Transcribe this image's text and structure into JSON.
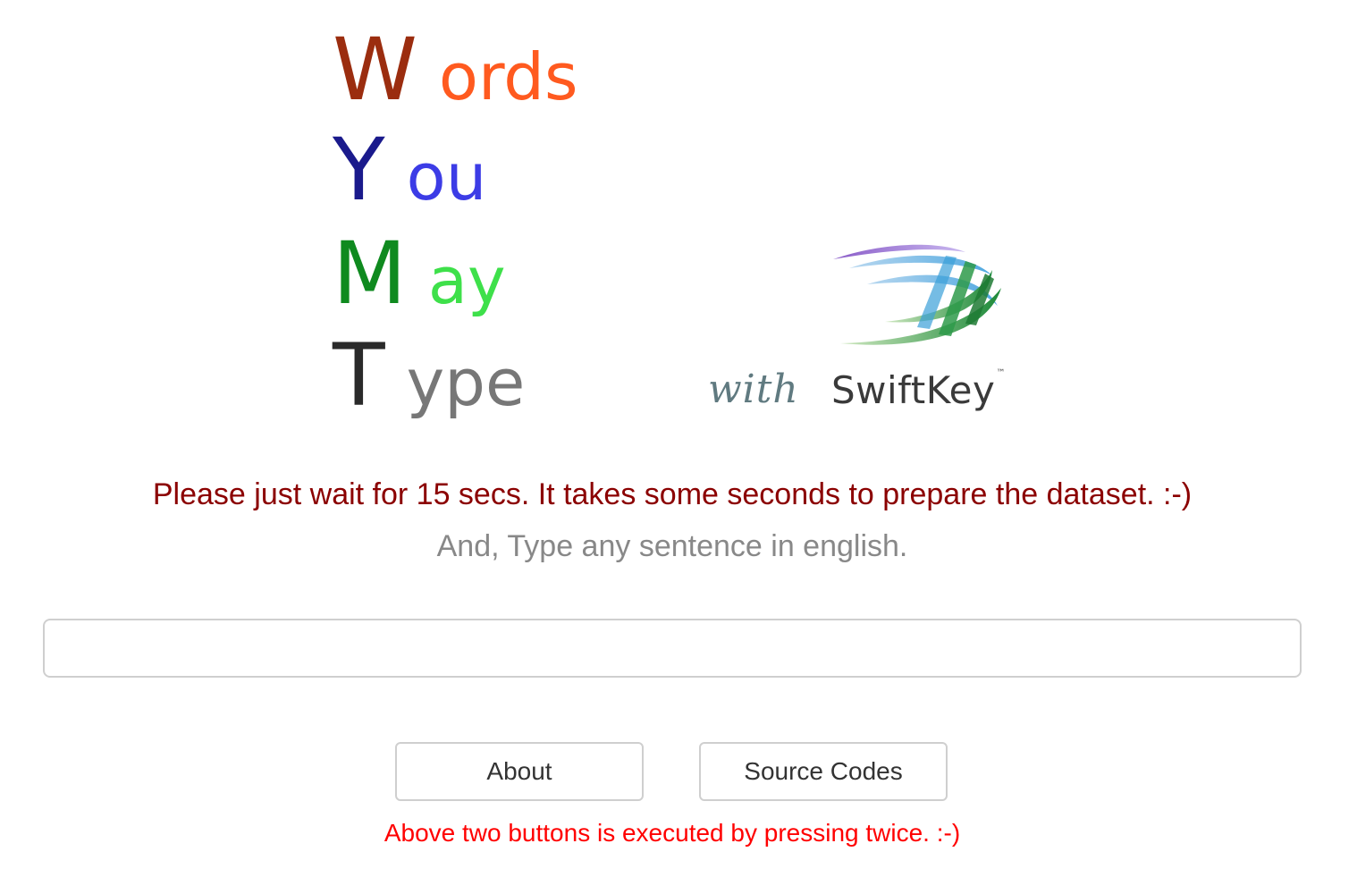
{
  "logo": {
    "rows": [
      {
        "cap": "W",
        "rest": "ords",
        "cap_color": "#9b2d0f",
        "rest_color": "#ff5a1f"
      },
      {
        "cap": "Y",
        "rest": "ou",
        "cap_color": "#1a1a8c",
        "rest_color": "#3c3ce6"
      },
      {
        "cap": "M",
        "rest": "ay",
        "cap_color": "#0f8a1f",
        "rest_color": "#3ee04a"
      },
      {
        "cap": "T",
        "rest": "ype",
        "cap_color": "#2a2a2a",
        "rest_color": "#777777"
      }
    ]
  },
  "swiftkey": {
    "with_text": "with",
    "name": "SwiftKey",
    "tm": "™"
  },
  "messages": {
    "wait": "Please just wait for 15 secs. It takes some seconds to prepare the dataset. :-)",
    "type_prompt": "And, Type any sentence in english.",
    "note": "Above two buttons is executed by pressing twice. :-)"
  },
  "input": {
    "value": "",
    "placeholder": ""
  },
  "buttons": {
    "about": "About",
    "source": "Source Codes"
  },
  "colors": {
    "wait": "#8b0000",
    "prompt": "#888888",
    "note": "#ff0000"
  }
}
